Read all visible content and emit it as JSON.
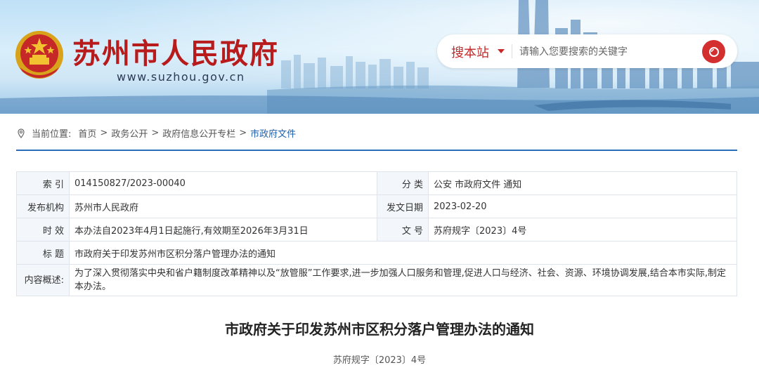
{
  "header": {
    "site_title": "苏州市人民政府",
    "site_domain": "www.suzhou.gov.cn",
    "search": {
      "scope_label": "搜本站",
      "placeholder": "请输入您要搜索的关键字",
      "value": ""
    }
  },
  "breadcrumb": {
    "prefix": "当前位置:",
    "items": [
      "首页",
      "政务公开",
      "政府信息公开专栏",
      "市政府文件"
    ]
  },
  "meta_table": {
    "index_label": "索  引",
    "index_value": "014150827/2023-00040",
    "category_label": "分  类",
    "category_value": "公安 市政府文件 通知",
    "issuer_label": "发布机构",
    "issuer_value": "苏州市人民政府",
    "date_label": "发文日期",
    "date_value": "2023-02-20",
    "validity_label": "时  效",
    "validity_value": "本办法自2023年4月1日起施行,有效期至2026年3月31日",
    "docno_label": "文  号",
    "docno_value": "苏府规字〔2023〕4号",
    "title_label": "标  题",
    "title_value": "市政府关于印发苏州市区积分落户管理办法的通知",
    "summary_label": "内容概述:",
    "summary_value": "为了深入贯彻落实中央和省户籍制度改革精神以及“放管服”工作要求,进一步加强人口服务和管理,促进人口与经济、社会、资源、环境协调发展,结合本市实际,制定本办法。"
  },
  "document": {
    "title": "市政府关于印发苏州市区积分落户管理办法的通知",
    "number": "苏府规字〔2023〕4号"
  },
  "colors": {
    "brand_red": "#b71b1b",
    "link_blue": "#1f5fa8",
    "rule_blue": "#2a6db8"
  }
}
